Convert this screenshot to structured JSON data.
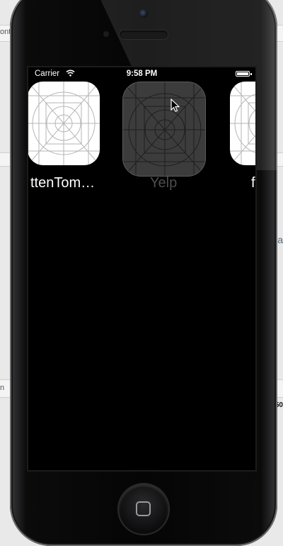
{
  "background": {
    "left_fragments": [
      "ont",
      "n"
    ],
    "right_fragments": [
      "a",
      "50"
    ]
  },
  "status_bar": {
    "carrier": "Carrier",
    "time": "9:58 PM",
    "battery_level": 1.0
  },
  "apps": [
    {
      "label": "ttenTom…",
      "state": "normal"
    },
    {
      "label": "Yelp",
      "state": "pressed"
    },
    {
      "label": "f",
      "state": "normal"
    }
  ],
  "colors": {
    "screen": "#000000",
    "icon_bg": "#ffffff",
    "icon_grid": "#b5b5b5",
    "pressed_icon_bg": "#3c3c3c"
  },
  "icons": {
    "app_placeholder": "app-icon-grid",
    "wifi": "wifi-icon",
    "battery": "battery-icon",
    "home": "home-button-icon"
  }
}
